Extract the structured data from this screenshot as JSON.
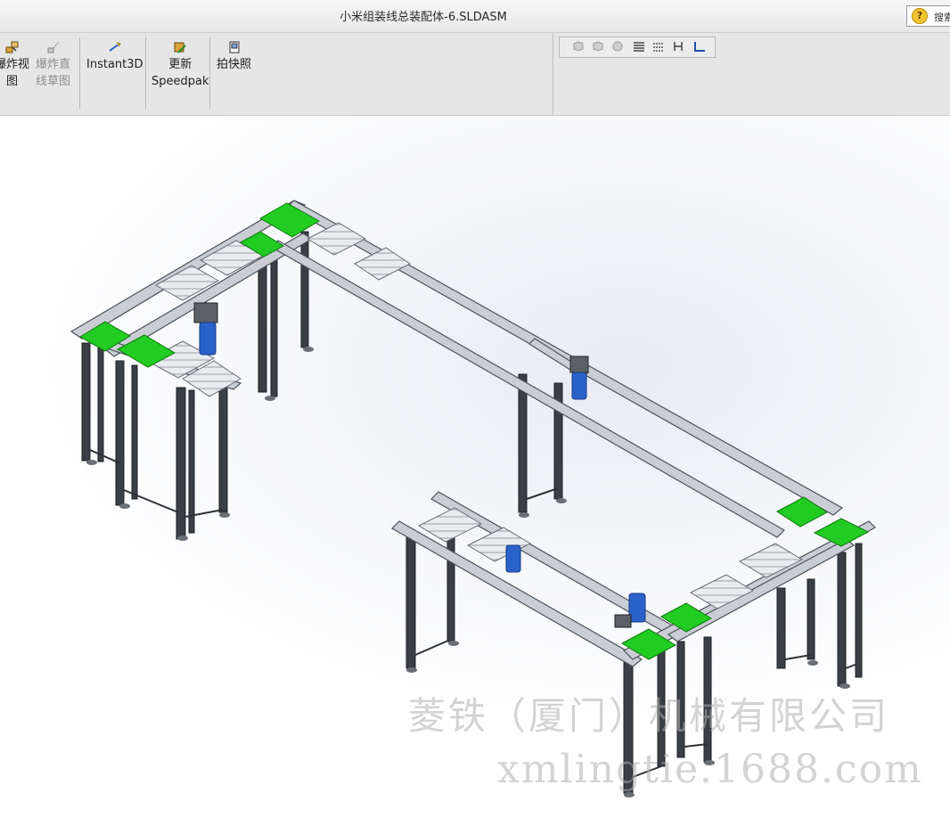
{
  "window": {
    "title": "小米组装线总装配体-6.SLDASM"
  },
  "help": {
    "search_label": "搜索"
  },
  "ribbon": {
    "explode_view": {
      "line1": "爆炸视",
      "line2": "图"
    },
    "explode_line": {
      "line1": "爆炸直",
      "line2": "线草图"
    },
    "instant3d": "Instant3D",
    "update_speedpak": {
      "line1": "更新",
      "line2": "Speedpak"
    },
    "snapshot": "拍快照"
  },
  "watermark": {
    "company": "菱铁（厦门）机械有限公司",
    "url": "xmlingtie.1688.com"
  },
  "colors": {
    "belt_green": "#22cc22",
    "motor_blue": "#2a62c9",
    "frame_gray": "#8e9399"
  }
}
